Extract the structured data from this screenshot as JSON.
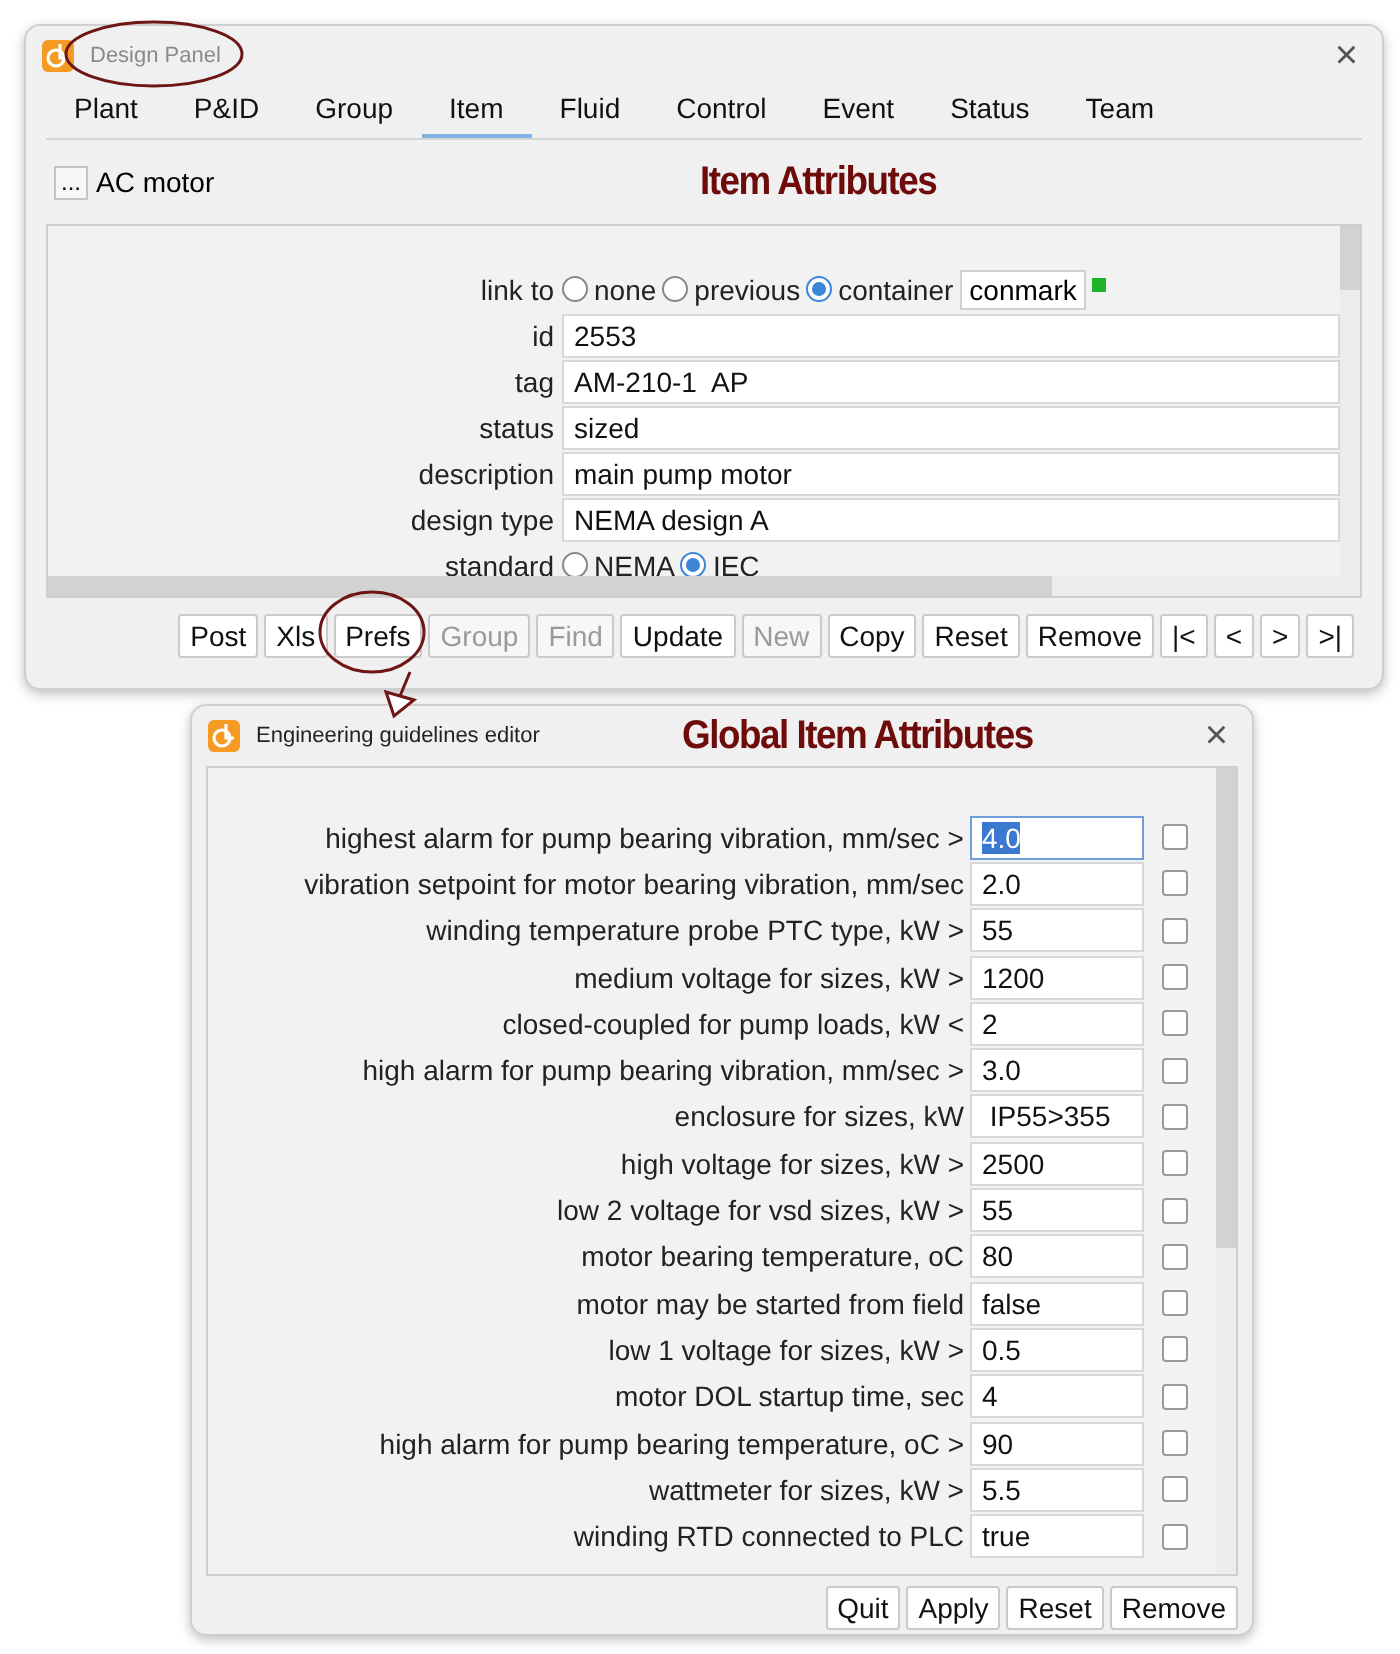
{
  "design_panel": {
    "title": "Design Panel",
    "close": "×",
    "tabs": [
      {
        "label": "Plant",
        "selected": false
      },
      {
        "label": "P&ID",
        "selected": false
      },
      {
        "label": "Group",
        "selected": false
      },
      {
        "label": "Item",
        "selected": true
      },
      {
        "label": "Fluid",
        "selected": false
      },
      {
        "label": "Control",
        "selected": false
      },
      {
        "label": "Event",
        "selected": false
      },
      {
        "label": "Status",
        "selected": false
      },
      {
        "label": "Team",
        "selected": false
      }
    ],
    "item": {
      "button": "...",
      "name": "AC motor"
    },
    "heading": "Item Attributes",
    "fields": [
      {
        "kind": "radio",
        "label": "link to",
        "options": [
          {
            "label": "none",
            "selected": false
          },
          {
            "label": "previous",
            "selected": false
          },
          {
            "label": "container",
            "selected": true
          }
        ],
        "link": "conmark"
      },
      {
        "kind": "text",
        "label": "id",
        "value": "2553"
      },
      {
        "kind": "text",
        "label": "tag",
        "value": "AM-210-1  AP"
      },
      {
        "kind": "text",
        "label": "status",
        "value": "sized"
      },
      {
        "kind": "text",
        "label": "description",
        "value": "main pump motor"
      },
      {
        "kind": "text",
        "label": "design type",
        "value": "NEMA design A"
      },
      {
        "kind": "radio",
        "label": "standard",
        "options": [
          {
            "label": "NEMA",
            "selected": false
          },
          {
            "label": "IEC",
            "selected": true
          }
        ]
      }
    ],
    "buttons": [
      {
        "label": "Post",
        "disabled": false
      },
      {
        "label": "Xls",
        "disabled": false
      },
      {
        "label": "Prefs",
        "disabled": false
      },
      {
        "label": "Group",
        "disabled": true
      },
      {
        "label": "Find",
        "disabled": true
      },
      {
        "label": "Update",
        "disabled": false
      },
      {
        "label": "New",
        "disabled": true
      },
      {
        "label": "Copy",
        "disabled": false
      },
      {
        "label": "Reset",
        "disabled": false
      },
      {
        "label": "Remove",
        "disabled": false
      },
      {
        "label": "|<",
        "disabled": false
      },
      {
        "label": "<",
        "disabled": false
      },
      {
        "label": ">",
        "disabled": false
      },
      {
        "label": ">|",
        "disabled": false
      }
    ]
  },
  "editor": {
    "title": "Engineering guidelines editor",
    "heading": "Global Item Attributes",
    "close": "×",
    "rows": [
      {
        "label": "highest alarm for pump bearing vibration, mm/sec >",
        "value": "4.0",
        "focused": true,
        "checked": false
      },
      {
        "label": "vibration setpoint for motor bearing vibration, mm/sec",
        "value": "2.0",
        "focused": false,
        "checked": false
      },
      {
        "label": "winding temperature probe PTC type, kW >",
        "value": "55",
        "focused": false,
        "checked": false
      },
      {
        "label": "medium voltage for sizes, kW >",
        "value": "1200",
        "focused": false,
        "checked": false
      },
      {
        "label": "closed-coupled for pump loads, kW <",
        "value": "2",
        "focused": false,
        "checked": false
      },
      {
        "label": "high alarm for pump bearing vibration, mm/sec >",
        "value": "3.0",
        "focused": false,
        "checked": false
      },
      {
        "label": "enclosure for sizes, kW",
        "value": " IP55>355",
        "focused": false,
        "checked": false
      },
      {
        "label": "high voltage for sizes, kW >",
        "value": "2500",
        "focused": false,
        "checked": false
      },
      {
        "label": "low 2 voltage for vsd sizes, kW >",
        "value": "55",
        "focused": false,
        "checked": false
      },
      {
        "label": "motor bearing temperature, oC",
        "value": "80",
        "focused": false,
        "checked": false
      },
      {
        "label": "motor may be started from field",
        "value": "false",
        "focused": false,
        "checked": false
      },
      {
        "label": "low 1 voltage for sizes, kW >",
        "value": "0.5",
        "focused": false,
        "checked": false
      },
      {
        "label": "motor DOL startup time, sec",
        "value": "4",
        "focused": false,
        "checked": false
      },
      {
        "label": "high alarm for pump bearing temperature, oC >",
        "value": "90",
        "focused": false,
        "checked": false
      },
      {
        "label": "wattmeter for sizes, kW >",
        "value": "5.5",
        "focused": false,
        "checked": false
      },
      {
        "label": "winding RTD connected to PLC",
        "value": "true",
        "focused": false,
        "checked": false
      }
    ],
    "buttons": [
      "Quit",
      "Apply",
      "Reset",
      "Remove"
    ]
  }
}
